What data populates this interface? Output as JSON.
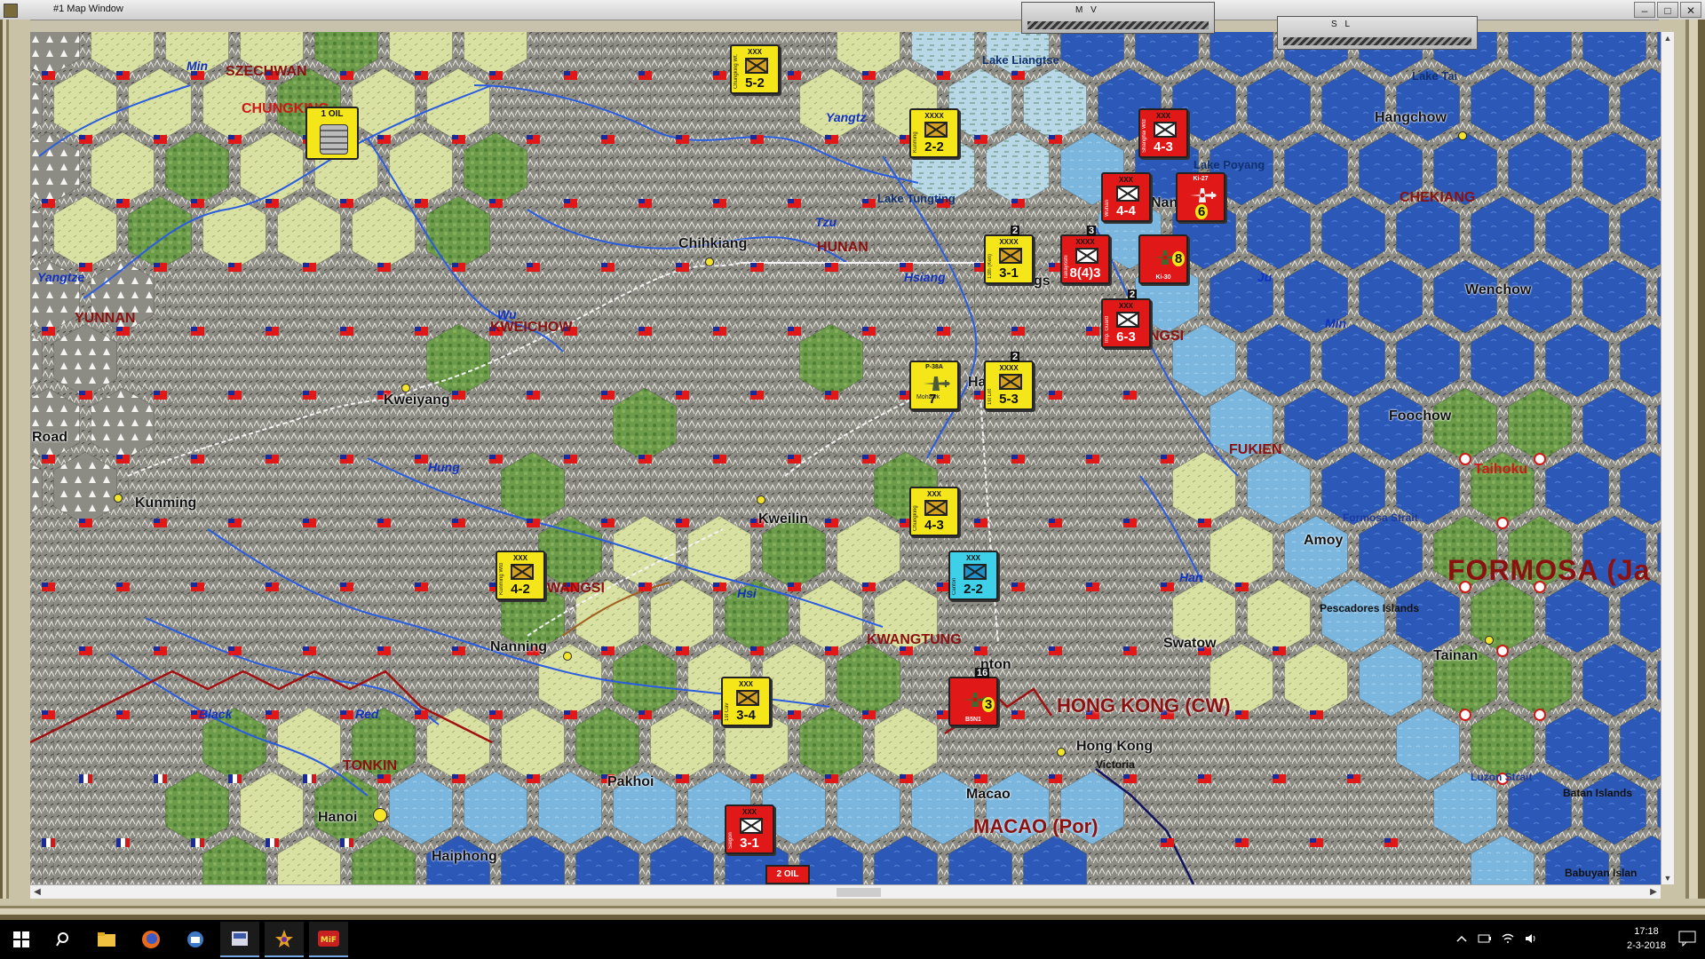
{
  "window": {
    "title": "#1 Map Window",
    "panel_mv": "M V",
    "panel_sl": "S L"
  },
  "map": {
    "cities": [
      {
        "key": "chihkiang",
        "label": "Chihkiang"
      },
      {
        "key": "kweiyang",
        "label": "Kweiyang"
      },
      {
        "key": "kunming",
        "label": "Kunming"
      },
      {
        "key": "kweilin",
        "label": "Kweilin"
      },
      {
        "key": "nanning",
        "label": "Nanning"
      },
      {
        "key": "hanoi",
        "label": "Hanoi"
      },
      {
        "key": "haiphong",
        "label": "Haiphong"
      },
      {
        "key": "pakhoi",
        "label": "Pakhoi"
      },
      {
        "key": "macao",
        "label": "Macao"
      },
      {
        "key": "hongkong",
        "label": "Hong Kong"
      },
      {
        "key": "victoria",
        "label": "Victoria"
      },
      {
        "key": "swatow",
        "label": "Swatow"
      },
      {
        "key": "amoy",
        "label": "Amoy"
      },
      {
        "key": "foochow",
        "label": "Foochow"
      },
      {
        "key": "wenchow",
        "label": "Wenchow"
      },
      {
        "key": "hangchow",
        "label": "Hangchow"
      },
      {
        "key": "tainan",
        "label": "Tainan"
      },
      {
        "key": "road",
        "label": "Road"
      }
    ],
    "partial_labels": {
      "chungking": "CHUNGKING",
      "canton_part": "nton",
      "changsha_part": "gs",
      "hankow_part": "Ha",
      "nanchang_part": "Nanc",
      "kiangsi_part": "NGSI",
      "kwangsi_part": "WANGSI",
      "taihoku": "Taihoku"
    },
    "provinces": {
      "szechwan": "SZECHWAN",
      "yunnan": "YUNNAN",
      "kweichow": "KWEICHOW",
      "hunan": "HUNAN",
      "fukien": "FUKIEN",
      "kwangtung": "KWANGTUNG",
      "chekiang": "CHEKIANG",
      "tonkin": "TONKIN"
    },
    "countries": {
      "hongkong": "HONG KONG (CW)",
      "macao": "MACAO (Por)",
      "formosa": "FORMOSA (Ja"
    },
    "rivers": {
      "min_w": "Min",
      "yangtze_w": "Yangtze",
      "yangtze_e": "Yangtz",
      "wu": "Wu",
      "hung": "Hung",
      "hsi": "Hsi",
      "black": "Black",
      "red": "Red",
      "hsiang": "Hsiang",
      "tzu": "Tzu",
      "ju": "Ju",
      "min_e": "Min",
      "han": "Han"
    },
    "lakes": {
      "liangtse": "Lake Liangtse",
      "tai": "Lake Tai",
      "poyang": "Lake Poyang",
      "tungting": "Lake Tungting"
    },
    "sea": {
      "formosa_strait": "Formosa Strait",
      "pescadores": "Pescadores Islands",
      "luzon_strait": "Luzon Strait",
      "batan": "Batan Islands",
      "babuyan": "Babuyan Islan"
    }
  },
  "units": [
    {
      "key": "u1",
      "side": "y",
      "size": "XXX",
      "name": "Chungking Wt.",
      "value": "5-2"
    },
    {
      "key": "u2",
      "side": "y",
      "size": "XXXX",
      "name": "Kunming",
      "value": "2-2"
    },
    {
      "key": "u3",
      "side": "y",
      "size": "XXXX",
      "name": "13th (Ken)",
      "value": "3-1",
      "stack": "2"
    },
    {
      "key": "u4",
      "side": "y",
      "size": "XXXX",
      "name": "1st Lnt",
      "value": "5-3",
      "stack": "2"
    },
    {
      "key": "u5",
      "side": "y",
      "size": "XXX",
      "name": "Chungking",
      "value": "4-3"
    },
    {
      "key": "u6",
      "side": "y",
      "size": "XXX",
      "name": "Kunming Wtd",
      "value": "4-2"
    },
    {
      "key": "u7",
      "side": "y",
      "size": "XXX",
      "name": "1st Cav",
      "value": "3-4"
    },
    {
      "key": "u8",
      "side": "r",
      "size": "XXX",
      "name": "Shanghai Wtd",
      "value": "4-3"
    },
    {
      "key": "u9",
      "side": "r",
      "size": "XXX",
      "name": "Wuhan",
      "value": "4-4"
    },
    {
      "key": "u10",
      "side": "r",
      "size": "XXXX",
      "name": "Takayoshi",
      "value": "8(4)3",
      "stack": "3"
    },
    {
      "key": "u11",
      "side": "r",
      "size": "XXX",
      "name": "Imp. Guard",
      "value": "6-3",
      "stack": "2"
    },
    {
      "key": "u12",
      "side": "r",
      "size": "XXX",
      "name": "Saigon",
      "value": "3-1"
    },
    {
      "key": "u13",
      "side": "c",
      "size": "XXX",
      "name": "Canton",
      "value": "2-2"
    }
  ],
  "air_units": [
    {
      "key": "a1",
      "side": "y",
      "name": "P-38A",
      "sub": "Mohawk",
      "value": "7"
    },
    {
      "key": "a2",
      "side": "r",
      "name": "Ki-27",
      "value": "6"
    },
    {
      "key": "a3",
      "side": "r",
      "name": "Ki-30",
      "value": "8"
    },
    {
      "key": "a4",
      "side": "r",
      "name": "B5N1",
      "value": "3",
      "stack": "16"
    }
  ],
  "resources": {
    "oil1": "1 OIL",
    "oil2": "2 OIL"
  },
  "taskbar": {
    "time": "17:18",
    "date": "2-3-2018",
    "apps": [
      "start-icon",
      "search-icon",
      "file-explorer-icon",
      "firefox-icon",
      "mail-icon",
      "app-icon",
      "game-icon",
      "mwif-icon"
    ]
  },
  "colors": {
    "china_flag_red": "#e01818",
    "china_flag_blue": "#1a2a9a",
    "allied_unit": "#f5e61a",
    "axis_unit": "#e01818",
    "naval_unit": "#3ed0e8",
    "sea": "#2a56b8",
    "coast": "#7fb8e0",
    "mountain": "#8a8a80",
    "clear": "#d9e2a4",
    "forest": "#6a9a48",
    "province_label": "#8b1010"
  }
}
